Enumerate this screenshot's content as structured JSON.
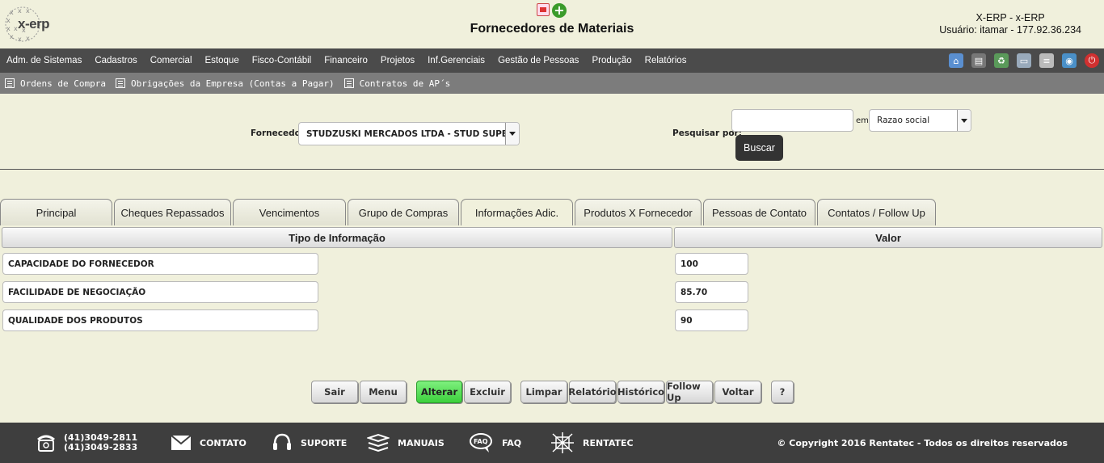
{
  "header": {
    "logo_text": "x-erp",
    "title": "Fornecedores de Materiais",
    "system_name": "X-ERP - x-ERP",
    "user_line": "Usuário: itamar - 177.92.36.234"
  },
  "menu": {
    "items": [
      "Adm. de Sistemas",
      "Cadastros",
      "Comercial",
      "Estoque",
      "Fisco-Contábil",
      "Financeiro",
      "Projetos",
      "Inf.Gerenciais",
      "Gestão de Pessoas",
      "Produção",
      "Relatórios"
    ]
  },
  "submenu": {
    "items": [
      "Ordens de Compra",
      "Obrigações da Empresa (Contas a Pagar)",
      "Contratos de AP´s"
    ]
  },
  "filters": {
    "fornecedor_label": "Fornecedor",
    "fornecedor_value": "STUDZUSKI MERCADOS LTDA - STUD SUPERMERCADOS",
    "pesquisar_label": "Pesquisar por:",
    "search_value": "",
    "em_label": "em",
    "em_value": "Razao social",
    "buscar_label": "Buscar"
  },
  "tabs": [
    "Principal",
    "Cheques Repassados",
    "Vencimentos",
    "Grupo de Compras",
    "Informações Adic.",
    "Produtos X Fornecedor",
    "Pessoas de Contato",
    "Contatos / Follow Up"
  ],
  "active_tab": "Informações Adic.",
  "table": {
    "headers": [
      "Tipo de Informação",
      "Valor"
    ],
    "rows": [
      {
        "info": "CAPACIDADE DO FORNECEDOR",
        "valor": "100"
      },
      {
        "info": "FACILIDADE DE NEGOCIAÇÃO",
        "valor": "85.70"
      },
      {
        "info": "QUALIDADE DOS PRODUTOS",
        "valor": "90"
      }
    ]
  },
  "buttons": {
    "sair": "Sair",
    "menu": "Menu",
    "alterar": "Alterar",
    "excluir": "Excluir",
    "limpar": "Limpar",
    "relatorio": "Relatório",
    "historico": "Histórico",
    "follow_up": "Follow Up",
    "voltar": "Voltar",
    "help": "?"
  },
  "footer": {
    "phone1": "(41)3049-2811",
    "phone2": "(41)3049-2833",
    "contato": "CONTATO",
    "suporte": "SUPORTE",
    "manuais": "MANUAIS",
    "faq": "FAQ",
    "faq_icon_text": "FAQ",
    "rentatec": "RENTATEC",
    "copyright": "© Copyright 2016 Rentatec - Todos os direitos reservados"
  },
  "colors": {
    "background": "#f0f0dc",
    "menubar": "#4b4b4b",
    "submenu": "#7c7c7c",
    "footer": "#3e3e3e",
    "alterar_button": "#5ee05e"
  }
}
